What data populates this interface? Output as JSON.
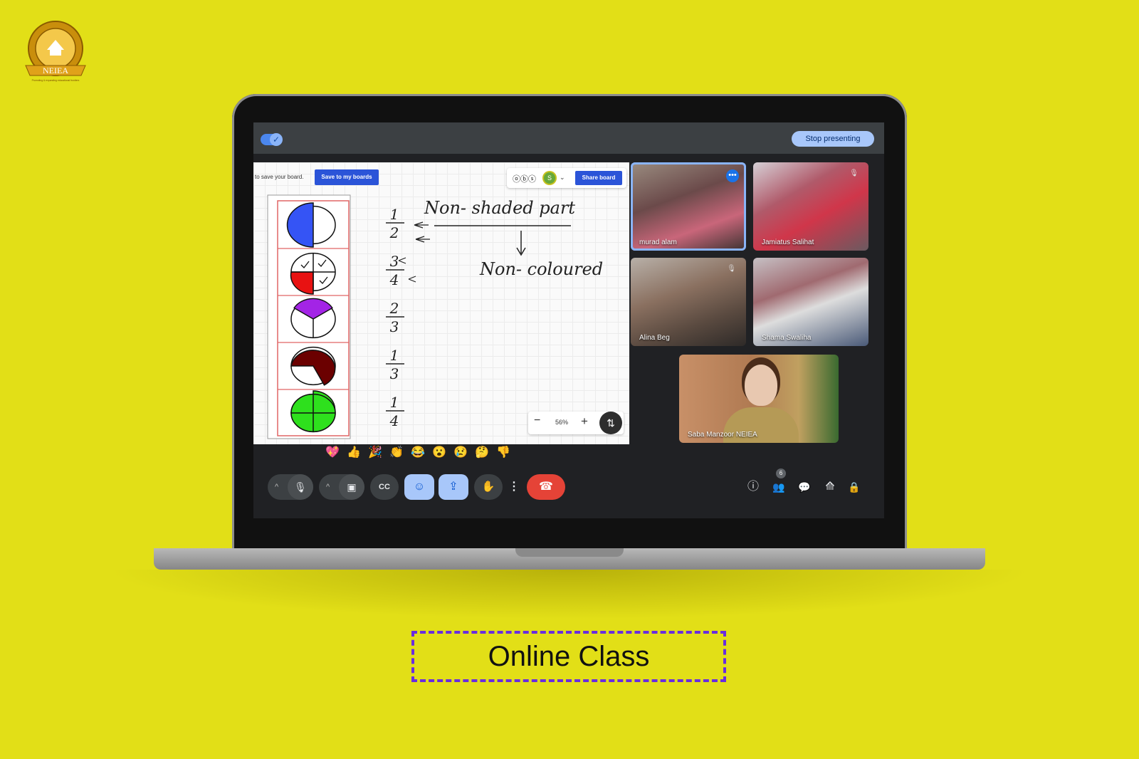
{
  "logo": {
    "text": "NEIEA",
    "ring_text": "NEW EDUCATION & INNOVATIVE EDUCATIONAL ALLIANCE",
    "tagline": "Promoting & expanding educational frontiers"
  },
  "meet": {
    "stop_presenting": "Stop presenting",
    "board": {
      "save_hint": "to save your board.",
      "save_button": "Save to my boards",
      "collab_glyph": "ⓞⓑⓢ",
      "avatar_letter": "S",
      "share_button": "Share board",
      "zoom": "56%",
      "handwriting": {
        "title": "Non- shaded part",
        "subtitle": "Non- coloured",
        "fractions": [
          {
            "num": "1",
            "den": "2"
          },
          {
            "num": "3",
            "den": "4"
          },
          {
            "num": "2",
            "den": "3"
          },
          {
            "num": "1",
            "den": "3"
          },
          {
            "num": "1",
            "den": "4"
          }
        ]
      },
      "circle_colors": [
        "#3554f5",
        "#e81212",
        "#a324e6",
        "#6b0000",
        "#2ee01d"
      ]
    },
    "participants": [
      {
        "name": "murad alam"
      },
      {
        "name": "Jamiatus Salihat"
      },
      {
        "name": "Alina Beg"
      },
      {
        "name": "Shama Swaliha"
      },
      {
        "name": "Saba Manzoor NEIEA"
      }
    ],
    "reactions": [
      "💖",
      "👍",
      "🎉",
      "👏",
      "😂",
      "😮",
      "😢",
      "🤔",
      "👎"
    ],
    "people_count": "6",
    "controls": {
      "mic": "🎙",
      "camera": "▣",
      "captions": "CC",
      "emoji": "☺",
      "present": "⇪",
      "hand": "✋",
      "more": "⋮",
      "end": "☎",
      "info": "ⓘ",
      "people": "👥",
      "chat": "💬",
      "activities": "⟰",
      "host": "🔒"
    }
  },
  "caption": "Online Class",
  "colors": {
    "background": "#e2df17",
    "caption_border": "#6a2dde",
    "end_call": "#e54337",
    "accent": "#a8c7fa"
  }
}
